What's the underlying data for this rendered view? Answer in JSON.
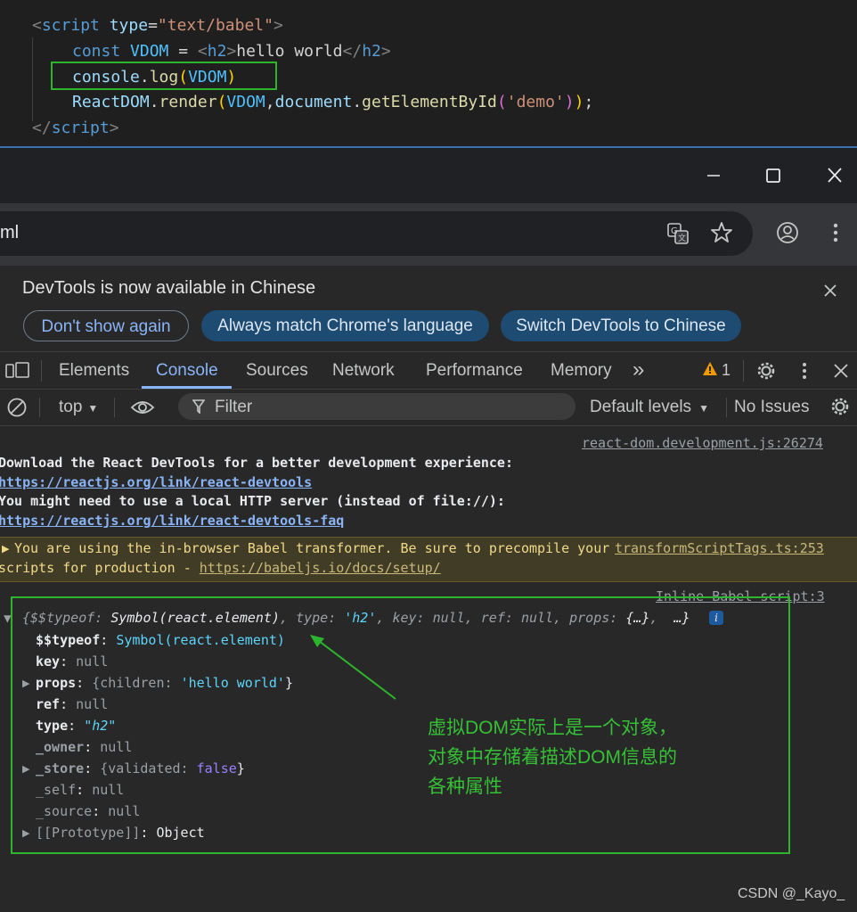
{
  "editor": {
    "lines": [
      {
        "open_tag": "<",
        "tag": "script",
        "attr": "type",
        "eq": "=",
        "value": "\"text/babel\"",
        "close": ">"
      },
      {
        "kw": "const",
        "var": "VDOM",
        "op": "=",
        "lt": "<",
        "tag": "h2",
        "gt": ">",
        "text": "hello world",
        "end_lt": "</",
        "end_tag": "h2",
        "end_gt": ">"
      },
      {
        "obj": "console",
        "dot": ".",
        "fn": "log",
        "lp": "(",
        "arg": "VDOM",
        "rp": ")"
      },
      {
        "obj": "ReactDOM",
        "dot": ".",
        "fn": "render",
        "lp": "(",
        "arg1": "VDOM",
        "comma": ",",
        "obj2": "document",
        "dot2": ".",
        "fn2": "getElementById",
        "lp2": "(",
        "str": "'demo'",
        "rp2": ")",
        "rp": ")",
        "semi": ";"
      },
      {
        "open_tag": "</",
        "tag": "script",
        "close": ">"
      }
    ]
  },
  "window": {
    "minimize_icon": "minimize-icon",
    "maximize_icon": "maximize-icon",
    "close_icon": "close-icon"
  },
  "address_bar": {
    "url_fragment": "ml",
    "icons": [
      "translate-icon",
      "star-icon",
      "profile-icon",
      "more-vert-icon"
    ]
  },
  "banner": {
    "title": "DevTools is now available in Chinese",
    "buttons": [
      "Don't show again",
      "Always match Chrome's language",
      "Switch DevTools to Chinese"
    ]
  },
  "tabs": {
    "items": [
      "Elements",
      "Console",
      "Sources",
      "Network",
      "Performance",
      "Memory"
    ],
    "active": "Console",
    "overflow": "»",
    "warning_count": "1"
  },
  "filter_bar": {
    "context": "top",
    "filter_placeholder": "Filter",
    "levels": "Default levels",
    "issues": "No Issues"
  },
  "console": {
    "msg1_source": "react-dom.development.js:26274",
    "msg1_lines": [
      "Download the React DevTools for a better development experience:",
      "https://reactjs.org/link/react-devtools",
      "You might need to use a local HTTP server (instead of file://):",
      "https://reactjs.org/link/react-devtools-faq"
    ],
    "warn_text1": "You are using the in-browser Babel transformer. Be sure to precompile your",
    "warn_source": "transformScriptTags.ts:253",
    "warn_text2": "scripts for production - ",
    "warn_link": "https://babeljs.io/docs/setup/",
    "obj_source": "Inline Babel script:3",
    "obj_summary": {
      "k1": "$$typeof",
      "v1": "Symbol(react.element)",
      "k2": "type",
      "v2": "'h2'",
      "k3": "key",
      "v3": "null",
      "k4": "ref",
      "v4": "null",
      "k5": "props",
      "v5": "{…}",
      "more": "…}",
      "info": "i"
    },
    "props": [
      {
        "key": "$$typeof",
        "value": "Symbol(react.element)"
      },
      {
        "key": "key",
        "value": "null"
      },
      {
        "key": "props",
        "value_pre": "{children: ",
        "value_str": "'hello world'",
        "value_post": "}"
      },
      {
        "key": "ref",
        "value": "null"
      },
      {
        "key": "type",
        "value": "\"h2\""
      },
      {
        "key": "_owner",
        "value": "null"
      },
      {
        "key": "_store",
        "value_pre": "{validated: ",
        "value_str": "false",
        "value_post": "}"
      },
      {
        "key": "_self",
        "value": "null"
      },
      {
        "key": "_source",
        "value": "null"
      },
      {
        "key": "[[Prototype]]",
        "value": "Object"
      }
    ]
  },
  "annotation": {
    "lines": [
      "虚拟DOM实际上是一个对象，",
      "对象中存储着描述DOM信息的",
      "各种属性"
    ],
    "color": "#35c035"
  },
  "watermark": "CSDN @_Kayo_"
}
